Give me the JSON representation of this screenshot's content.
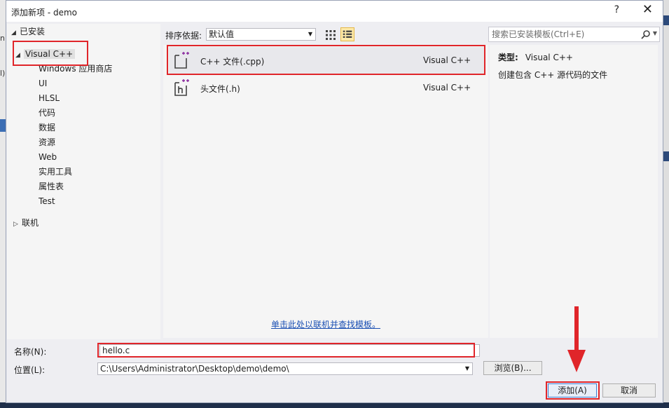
{
  "dialog": {
    "title": "添加新项 - demo",
    "help_label": "?",
    "close_label": "✕"
  },
  "tree": {
    "installed_label": "已安装",
    "root_label": "Visual C++",
    "children": [
      "Windows 应用商店",
      "UI",
      "HLSL",
      "代码",
      "数据",
      "资源",
      "Web",
      "实用工具",
      "属性表",
      "Test"
    ],
    "online_label": "联机"
  },
  "sort": {
    "label": "排序依据:",
    "value": "默认值"
  },
  "templates": [
    {
      "name": "C++ 文件(.cpp)",
      "lang": "Visual C++",
      "icon": "cpp-file-icon"
    },
    {
      "name": "头文件(.h)",
      "lang": "Visual C++",
      "icon": "header-file-icon"
    }
  ],
  "online_link": "单击此处以联机并查找模板。",
  "search": {
    "placeholder": "搜索已安装模板(Ctrl+E)"
  },
  "details": {
    "type_label": "类型:",
    "type_value": "Visual C++",
    "description": "创建包含 C++ 源代码的文件"
  },
  "form": {
    "name_label": "名称(N):",
    "name_value": "hello.c",
    "location_label": "位置(L):",
    "location_value": "C:\\Users\\Administrator\\Desktop\\demo\\demo\\",
    "browse_label": "浏览(B)...",
    "add_label": "添加(A)",
    "cancel_label": "取消"
  },
  "colors": {
    "accent_red": "#e0252a",
    "link_blue": "#1a4fb3",
    "icon_purple": "#8a2a9e"
  }
}
